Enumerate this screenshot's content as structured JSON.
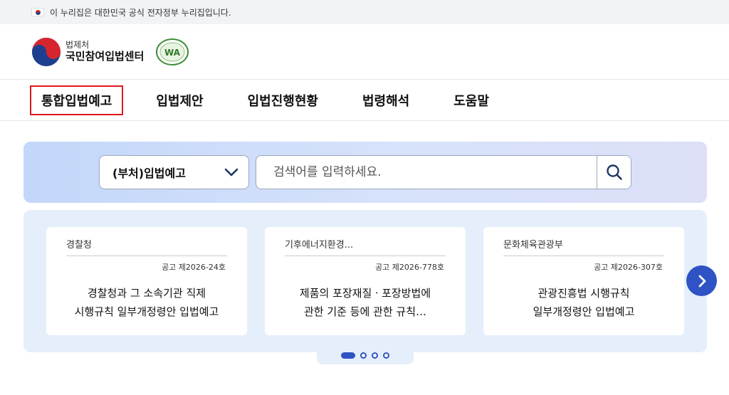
{
  "gov_banner": {
    "text": "이 누리집은 대한민국 공식 전자정부 누리집입니다."
  },
  "header": {
    "org_name": "법제처",
    "site_name": "국민참여입법센터",
    "wa_mark_text": "WA"
  },
  "gnb": {
    "items": [
      {
        "label": "통합입법예고",
        "active": true
      },
      {
        "label": "입법제안",
        "active": false
      },
      {
        "label": "입법진행현황",
        "active": false
      },
      {
        "label": "법령해석",
        "active": false
      },
      {
        "label": "도움말",
        "active": false
      }
    ]
  },
  "search": {
    "category_selected": "(부처)입법예고",
    "placeholder": "검색어를 입력하세요.",
    "value": ""
  },
  "cards": [
    {
      "org": "경찰청",
      "notice_no": "공고 제2026-24호",
      "title_line1": "경찰청과 그 소속기관 직제",
      "title_line2": "시행규칙 일부개정령안 입법예고"
    },
    {
      "org": "기후에너지환경...",
      "notice_no": "공고 제2026-778호",
      "title_line1": "제품의 포장재질ㆍ포장방법에",
      "title_line2": "관한 기준 등에 관한 규칙…"
    },
    {
      "org": "문화체육관광부",
      "notice_no": "공고 제2026-307호",
      "title_line1": "관광진흥법 시행규칙",
      "title_line2": "일부개정령안 입법예고"
    }
  ],
  "pager": {
    "total": 4,
    "current": 1
  },
  "colors": {
    "accent": "#2f53c4",
    "active_nav_border": "#e0191e",
    "card_area_bg": "#e5effb"
  }
}
